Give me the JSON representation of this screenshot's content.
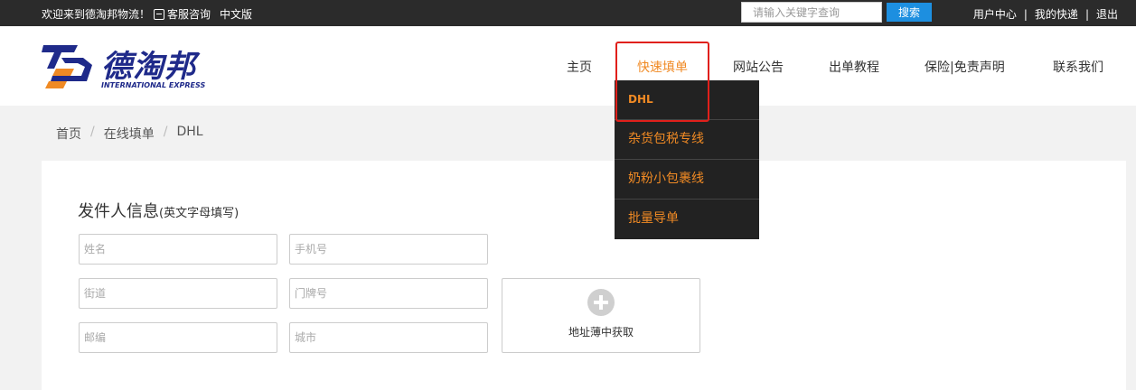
{
  "topbar": {
    "welcome": "欢迎来到德淘邦物流！",
    "service": "客服咨询",
    "language": "中文版",
    "search_placeholder": "请输入关键字查询",
    "search_button": "搜索",
    "links": [
      "用户中心",
      "我的快递",
      "退出"
    ]
  },
  "logo": {
    "name": "德淘邦",
    "subtitle": "INTERNATIONAL EXPRESS"
  },
  "nav": {
    "items": [
      "主页",
      "快速填单",
      "网站公告",
      "出单教程",
      "保险|免责声明",
      "联系我们"
    ],
    "active": "快速填单"
  },
  "dropdown": {
    "items": [
      "DHL",
      "杂货包税专线",
      "奶粉小包裹线",
      "批量导单"
    ]
  },
  "breadcrumb": {
    "items": [
      "首页",
      "在线填单",
      "DHL"
    ]
  },
  "form": {
    "title": "发件人信息",
    "title_note": "(英文字母填写)",
    "placeholders": {
      "name": "姓名",
      "phone": "手机号",
      "street": "街道",
      "house_number": "门牌号",
      "postcode": "邮编",
      "city": "城市"
    },
    "address_book": "地址薄中获取"
  },
  "colors": {
    "accent": "#f08a24",
    "topbar": "#2b2b2b",
    "search_button": "#1d8fe0",
    "logo": "#1f2a8a",
    "highlight": "#e0201b"
  }
}
